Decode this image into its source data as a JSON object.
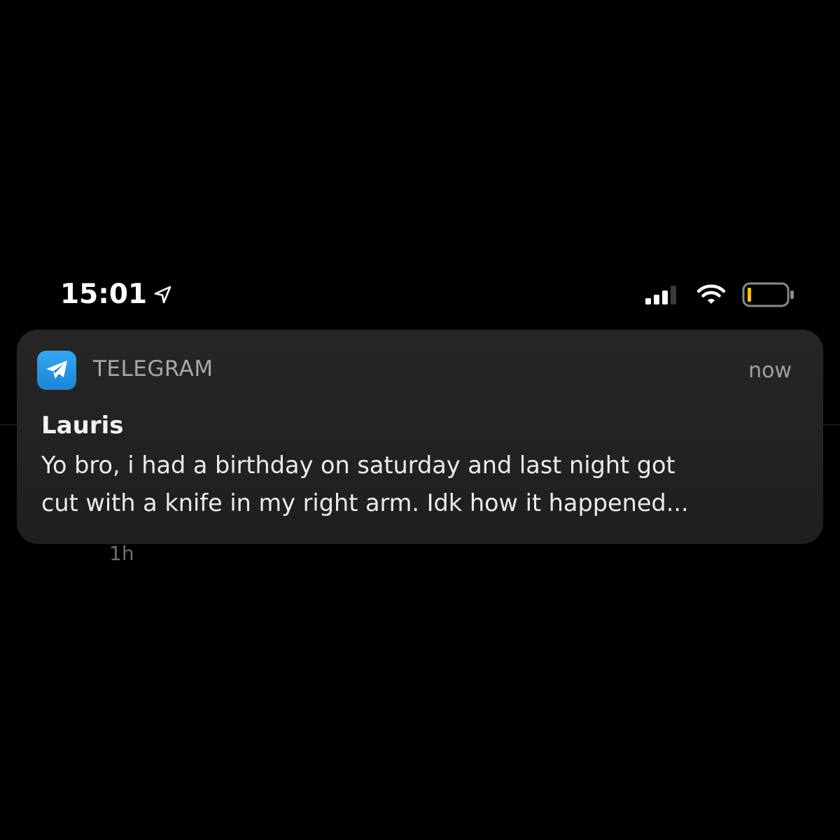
{
  "status_bar": {
    "time": "15:01",
    "icons": [
      "location-arrow-icon",
      "cellular-signal-icon",
      "wifi-icon",
      "battery-low-icon"
    ],
    "battery_color": "#f5c400"
  },
  "notification": {
    "app_icon": "telegram-icon",
    "app_name": "TELEGRAM",
    "time": "now",
    "sender": "Lauris",
    "message": "Yo bro, i had a birthday on saturday and last night got\ncut with a knife in my right arm. Idk how it happened...",
    "accent_color": "#2aa3ef"
  },
  "background": {
    "older_notification_time": "1h"
  }
}
